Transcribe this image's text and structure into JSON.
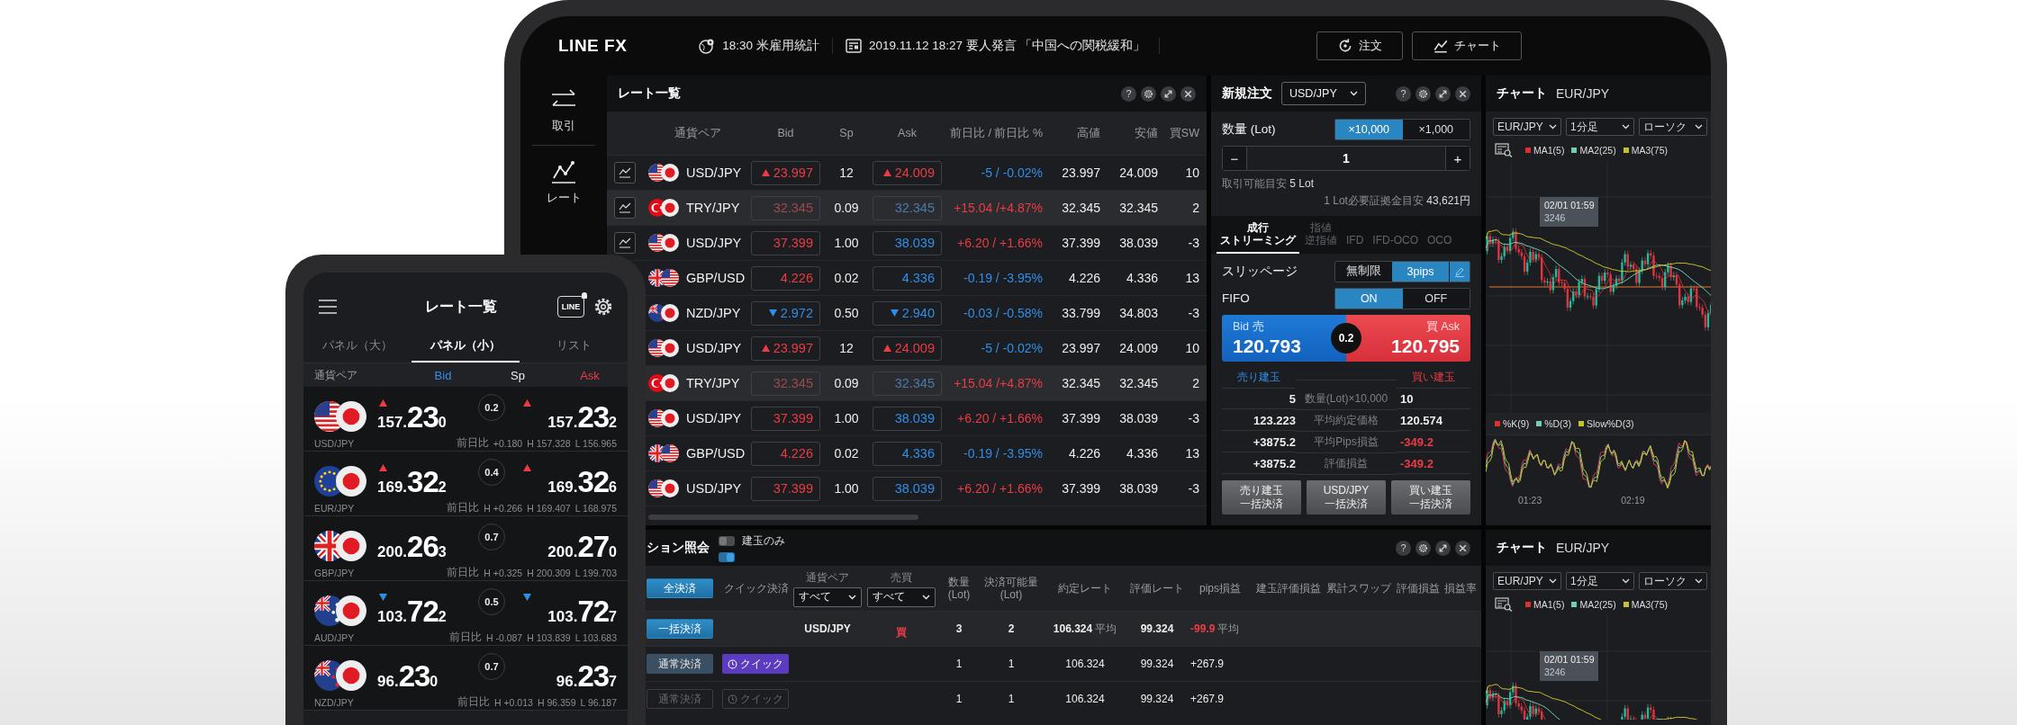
{
  "header": {
    "logo": "LINE FX",
    "news": [
      {
        "kind": "event",
        "text": "18:30 米雇用統計"
      },
      {
        "kind": "news",
        "text": "2019.11.12 18:27 要人発言 「中国への関税緩和」"
      }
    ],
    "buttons": [
      {
        "kind": "order",
        "label": "注文"
      },
      {
        "kind": "chart",
        "label": "チャート"
      }
    ]
  },
  "sidebar": {
    "items": [
      {
        "kind": "trade",
        "label": "取引"
      },
      {
        "kind": "chart",
        "label": "レート"
      }
    ]
  },
  "rate_panel": {
    "title": "レート一覧",
    "help": "?",
    "columns": [
      "通貨ペア",
      "Bid",
      "Sp",
      "Ask",
      "前日比 / 前日比 %",
      "高値",
      "安値",
      "買SW"
    ],
    "rows": [
      {
        "flags": [
          {
            "kind": "us"
          },
          {
            "kind": "jp"
          }
        ],
        "pair": "USD/JPY",
        "bid": "23.997",
        "bid_up": true,
        "bid_down": false,
        "spread": "12",
        "ask": "24.009",
        "ask_up": true,
        "ask_down": false,
        "change": "-5 / -0.02%",
        "change_negative": true,
        "high": "23.997",
        "low": "24.009",
        "swap": "10",
        "stale": false,
        "selected": false
      },
      {
        "flags": [
          {
            "kind": "tr"
          },
          {
            "kind": "jp"
          }
        ],
        "pair": "TRY/JPY",
        "bid": "32.345",
        "bid_up": false,
        "bid_down": false,
        "spread": "0.09",
        "ask": "32.345",
        "ask_up": false,
        "ask_down": false,
        "change": "+15.04 /+4.87%",
        "change_negative": false,
        "high": "32.345",
        "low": "32.345",
        "swap": "2",
        "stale": true,
        "selected": true
      },
      {
        "flags": [
          {
            "kind": "us"
          },
          {
            "kind": "jp"
          }
        ],
        "pair": "USD/JPY",
        "bid": "37.399",
        "bid_up": false,
        "bid_down": false,
        "spread": "1.00",
        "ask": "38.039",
        "ask_up": false,
        "ask_down": false,
        "change": "+6.20 / +1.66%",
        "change_negative": false,
        "high": "37.399",
        "low": "38.039",
        "swap": "-3",
        "stale": false,
        "selected": false
      },
      {
        "flags": [
          {
            "kind": "gb"
          },
          {
            "kind": "us"
          }
        ],
        "pair": "GBP/USD",
        "bid": "4.226",
        "bid_up": false,
        "bid_down": false,
        "spread": "0.02",
        "ask": "4.336",
        "ask_up": false,
        "ask_down": false,
        "change": "-0.19 / -3.95%",
        "change_negative": true,
        "high": "4.226",
        "low": "4.336",
        "swap": "13",
        "stale": false,
        "selected": false
      },
      {
        "flags": [
          {
            "kind": "nz"
          },
          {
            "kind": "jp"
          }
        ],
        "pair": "NZD/JPY",
        "bid": "2.972",
        "bid_up": false,
        "bid_down": true,
        "spread": "0.50",
        "ask": "2.940",
        "ask_up": false,
        "ask_down": true,
        "change": "-0.03 / -0.58%",
        "change_negative": true,
        "high": "33.799",
        "low": "34.803",
        "swap": "-3",
        "stale": false,
        "selected": false
      },
      {
        "flags": [
          {
            "kind": "us"
          },
          {
            "kind": "jp"
          }
        ],
        "pair": "USD/JPY",
        "bid": "23.997",
        "bid_up": true,
        "bid_down": false,
        "spread": "12",
        "ask": "24.009",
        "ask_up": true,
        "ask_down": false,
        "change": "-5 / -0.02%",
        "change_negative": true,
        "high": "23.997",
        "low": "24.009",
        "swap": "10",
        "stale": false,
        "selected": false
      },
      {
        "flags": [
          {
            "kind": "tr"
          },
          {
            "kind": "jp"
          }
        ],
        "pair": "TRY/JPY",
        "bid": "32.345",
        "bid_up": false,
        "bid_down": false,
        "spread": "0.09",
        "ask": "32.345",
        "ask_up": false,
        "ask_down": false,
        "change": "+15.04 /+4.87%",
        "change_negative": false,
        "high": "32.345",
        "low": "32.345",
        "swap": "2",
        "stale": true,
        "selected": true
      },
      {
        "flags": [
          {
            "kind": "us"
          },
          {
            "kind": "jp"
          }
        ],
        "pair": "USD/JPY",
        "bid": "37.399",
        "bid_up": false,
        "bid_down": false,
        "spread": "1.00",
        "ask": "38.039",
        "ask_up": false,
        "ask_down": false,
        "change": "+6.20 / +1.66%",
        "change_negative": false,
        "high": "37.399",
        "low": "38.039",
        "swap": "-3",
        "stale": false,
        "selected": false
      },
      {
        "flags": [
          {
            "kind": "gb"
          },
          {
            "kind": "us"
          }
        ],
        "pair": "GBP/USD",
        "bid": "4.226",
        "bid_up": false,
        "bid_down": false,
        "spread": "0.02",
        "ask": "4.336",
        "ask_up": false,
        "ask_down": false,
        "change": "-0.19 / -3.95%",
        "change_negative": true,
        "high": "4.226",
        "low": "4.336",
        "swap": "13",
        "stale": false,
        "selected": false
      },
      {
        "flags": [
          {
            "kind": "us"
          },
          {
            "kind": "jp"
          }
        ],
        "pair": "USD/JPY",
        "bid": "37.399",
        "bid_up": false,
        "bid_down": false,
        "spread": "1.00",
        "ask": "38.039",
        "ask_up": false,
        "ask_down": false,
        "change": "+6.20 / +1.66%",
        "change_negative": false,
        "high": "37.399",
        "low": "38.039",
        "swap": "-3",
        "stale": false,
        "selected": false
      }
    ]
  },
  "order_panel": {
    "title": "新規注文",
    "help": "?",
    "pair_select": "USD/JPY",
    "quantity_label": "数量 (Lot)",
    "units": [
      {
        "label": "×10,000",
        "selected": true
      },
      {
        "label": "×1,000",
        "selected": false
      }
    ],
    "minus": "−",
    "quantity": "1",
    "plus": "+",
    "capacity_label": "取引可能目安",
    "capacity": "5 Lot",
    "margin_label": "1 Lot必要証拠金目安",
    "margin": "43,621円",
    "order_types": [
      {
        "label": "成行",
        "sublabel": "ストリーミング",
        "selected": true
      },
      {
        "label": "指値",
        "sublabel": "逆指値",
        "selected": false
      },
      {
        "label": "IFD",
        "selected": false
      },
      {
        "label": "IFD-OCO",
        "selected": false
      },
      {
        "label": "OCO",
        "selected": false
      }
    ],
    "slippage": {
      "label": "スリッページ",
      "options": [
        {
          "label": "無制限",
          "selected": false
        },
        {
          "label": "3pips",
          "selected": true
        }
      ]
    },
    "fifo": {
      "label": "FIFO",
      "options": [
        {
          "label": "ON",
          "selected": true
        },
        {
          "label": "OFF",
          "selected": false
        }
      ]
    },
    "quote": {
      "bid_label": "Bid 売",
      "bid": "120.793",
      "spread": "0.2",
      "ask_label": "買 Ask",
      "ask": "120.795"
    },
    "positions": {
      "sell_label": "売り建玉",
      "buy_label": "買い建玉",
      "rows": [
        {
          "sell": "5",
          "label": "数量(Lot)×10,000",
          "buy": "10",
          "buy_negative": false
        },
        {
          "sell": "123.223",
          "label": "平均約定価格",
          "buy": "120.574",
          "buy_negative": false
        },
        {
          "sell": "+3875.2",
          "label": "平均Pips損益",
          "buy": "-349.2",
          "buy_negative": true
        },
        {
          "sell": "+3875.2",
          "label": "評価損益",
          "buy": "-349.2",
          "buy_negative": true
        }
      ]
    },
    "actions": [
      {
        "label": "売り建玉",
        "sublabel": "一括決済"
      },
      {
        "label": "USD/JPY",
        "sublabel": "一括決済"
      },
      {
        "label": "買い建玉",
        "sublabel": "一括決済"
      }
    ]
  },
  "chart_panels": [
    {
      "title": "チャート",
      "pair": "EUR/JPY",
      "selects": [
        "EUR/JPY",
        "1分足",
        "ローソク"
      ],
      "legend": [
        {
          "label": "MA1(5)",
          "color": "#d8322c"
        },
        {
          "label": "MA2(25)",
          "color": "#6fcfae"
        },
        {
          "label": "MA3(75)",
          "color": "#c8c02a"
        }
      ],
      "tooltip": {
        "time": "02/01 01:59",
        "value": "3246"
      },
      "oscillator_legend": [
        {
          "label": "%K(9)",
          "color": "#d8322c"
        },
        {
          "label": "%D(3)",
          "color": "#6fcfae"
        },
        {
          "label": "Slow%D(3)",
          "color": "#c8c02a"
        }
      ],
      "time_labels": [
        "01:23",
        "02:19"
      ]
    },
    {
      "title": "チャート",
      "pair": "EUR/JPY",
      "selects": [
        "EUR/JPY",
        "1分足",
        "ローソク"
      ],
      "legend": [
        {
          "label": "MA1(5)",
          "color": "#d8322c"
        },
        {
          "label": "MA2(25)",
          "color": "#6fcfae"
        },
        {
          "label": "MA3(75)",
          "color": "#c8c02a"
        }
      ],
      "tooltip": {
        "time": "02/01 01:59",
        "value": "3246"
      }
    }
  ],
  "position_panel": {
    "title": "ション照会",
    "help": "?",
    "toggles": [
      {
        "label": "建玉のみ",
        "on": false
      },
      {
        "on": true
      }
    ],
    "close_all": "全決済",
    "columns": [
      {
        "label": "クイック決済"
      },
      {
        "label": "通貨ペア",
        "filter": "すべて"
      },
      {
        "label": "売買",
        "filter": "すべて"
      },
      {
        "label": "数量\n(Lot)"
      },
      {
        "label": "決済可能量\n(Lot)"
      },
      {
        "label": "約定レート"
      },
      {
        "label": "評価レート"
      },
      {
        "label": "pips損益"
      },
      {
        "label": "建玉評価損益"
      },
      {
        "label": "累計スワップ"
      },
      {
        "label": "評価損益"
      },
      {
        "label": "損益率"
      }
    ],
    "rows": [
      {
        "kind": "summary",
        "action": "一括決済",
        "disabled": false,
        "pair": "USD/JPY",
        "side": "買",
        "qty": "3",
        "closable": "2",
        "rate": "106.324",
        "rate_note": "平均",
        "eval_rate": "99.324",
        "pips": "-99.9",
        "pips_note": "平均",
        "pips_negative": true
      },
      {
        "kind": "detail",
        "action": "通常決済",
        "quick": "クイック",
        "disabled": false,
        "qty": "1",
        "closable": "1",
        "rate": "106.324",
        "eval_rate": "99.324",
        "pips": "+267.9",
        "pips_negative": false
      },
      {
        "kind": "detail",
        "action": "通常決済",
        "quick": "クイック",
        "disabled": true,
        "qty": "1",
        "closable": "1",
        "rate": "106.324",
        "eval_rate": "99.324",
        "pips": "+267.9",
        "pips_negative": false
      }
    ]
  },
  "phone": {
    "title": "レート一覧",
    "notify_label": "LINE",
    "tabs": [
      {
        "label": "パネル（大）",
        "selected": false
      },
      {
        "label": "パネル（小）",
        "selected": true
      },
      {
        "label": "リスト",
        "selected": false
      }
    ],
    "columns": [
      "通貨ペア",
      "Bid",
      "Sp",
      "Ask"
    ],
    "rows": [
      {
        "flags": [
          {
            "kind": "us"
          },
          {
            "kind": "jp"
          }
        ],
        "pair": "USD/JPY",
        "up": true,
        "down": false,
        "bid": {
          "head": "157.",
          "big": "23",
          "tail": "0"
        },
        "spread": "0.2",
        "ask": {
          "head": "157.",
          "big": "23",
          "tail": "2"
        },
        "change_label": "前日比",
        "change": "+0.180",
        "high": "H 157.328",
        "low": "L 156.965"
      },
      {
        "flags": [
          {
            "kind": "eu"
          },
          {
            "kind": "jp"
          }
        ],
        "pair": "EUR/JPY",
        "up": true,
        "down": false,
        "bid": {
          "head": "169.",
          "big": "32",
          "tail": "2"
        },
        "spread": "0.4",
        "ask": {
          "head": "169.",
          "big": "32",
          "tail": "6"
        },
        "change_label": "前日比",
        "change": "H +0.266",
        "high": "H 169.407",
        "low": "L 168.975"
      },
      {
        "flags": [
          {
            "kind": "gb"
          },
          {
            "kind": "jp"
          }
        ],
        "pair": "GBP/JPY",
        "up": false,
        "down": false,
        "bid": {
          "head": "200.",
          "big": "26",
          "tail": "3"
        },
        "spread": "0.7",
        "ask": {
          "head": "200.",
          "big": "27",
          "tail": "0"
        },
        "change_label": "前日比",
        "change": "H +0.325",
        "high": "H 200.309",
        "low": "L 199.703"
      },
      {
        "flags": [
          {
            "kind": "au"
          },
          {
            "kind": "jp"
          }
        ],
        "pair": "AUD/JPY",
        "up": false,
        "down": true,
        "bid": {
          "head": "103.",
          "big": "72",
          "tail": "2"
        },
        "spread": "0.5",
        "ask": {
          "head": "103.",
          "big": "72",
          "tail": "7"
        },
        "change_label": "前日比",
        "change": "H -0.087",
        "high": "H 103.839",
        "low": "L 103.683"
      },
      {
        "flags": [
          {
            "kind": "nz"
          },
          {
            "kind": "jp"
          }
        ],
        "pair": "NZD/JPY",
        "up": false,
        "down": false,
        "bid": {
          "head": "96.",
          "big": "23",
          "tail": "0"
        },
        "spread": "0.7",
        "ask": {
          "head": "96.",
          "big": "23",
          "tail": "7"
        },
        "change_label": "前日比",
        "change": "H +0.013",
        "high": "H 96.359",
        "low": "L 96.187"
      }
    ]
  }
}
